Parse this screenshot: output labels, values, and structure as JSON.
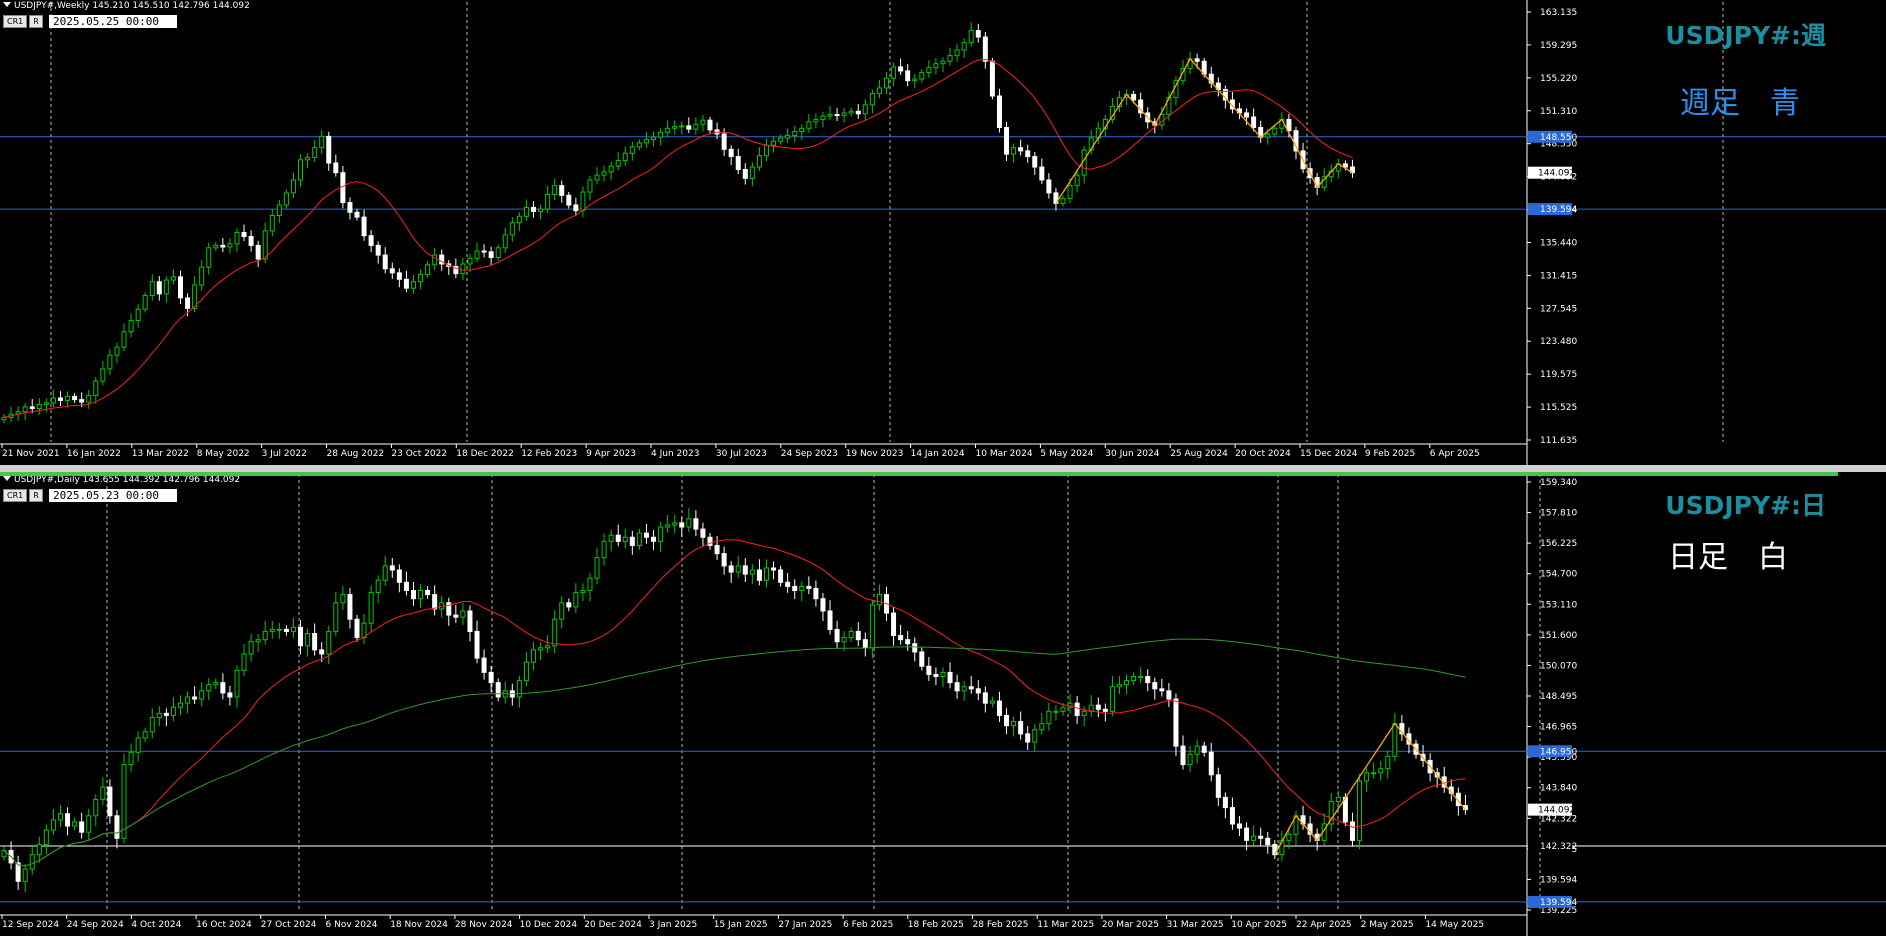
{
  "colors": {
    "background": "#000000",
    "up_candle": "#00c800",
    "down_candle": "#ffffff",
    "ma_red": "#ff2020",
    "ma_green": "#2e9a2e",
    "zigzag": "#ffa500",
    "hline_blue": "#2a6ad8",
    "hline_white": "#ffffff",
    "title_teal": "#1b8fa0",
    "weekly_note": "#2e8fe8"
  },
  "weekly": {
    "header": "USDJPY#,Weekly  145.210 145.510 142.796 144.092",
    "btn1": "CR1",
    "btn2": "R",
    "datetime": "2025.05.25 00:00",
    "title": "USDJPY#:週",
    "note": "週足　青",
    "price_labels": [
      "163.135",
      "159.295",
      "155.220",
      "151.310",
      "148.550",
      "144.092",
      "139.594",
      "135.440",
      "131.415",
      "127.545",
      "123.480",
      "119.575",
      "115.525",
      "111.635"
    ],
    "date_labels": [
      "21 Nov 2021",
      "16 Jan 2022",
      "13 Mar 2022",
      "8 May 2022",
      "3 Jul 2022",
      "28 Aug 2022",
      "23 Oct 2022",
      "18 Dec 2022",
      "12 Feb 2023",
      "9 Apr 2023",
      "4 Jun 2023",
      "30 Jul 2023",
      "24 Sep 2023",
      "19 Nov 2023",
      "14 Jan 2024",
      "10 Mar 2024",
      "5 May 2024",
      "30 Jun 2024",
      "25 Aug 2024",
      "20 Oct 2024",
      "15 Dec 2024",
      "9 Feb 2025",
      "6 Apr 2025"
    ],
    "hlines": [
      {
        "label": "148.550",
        "value": 148.55,
        "color": "#2a6ad8"
      },
      {
        "label": "139.594",
        "value": 139.594,
        "color": "#2a6ad8"
      }
    ],
    "current_label": "144.092"
  },
  "daily": {
    "header": "USDJPY#,Daily  143.655 144.392 142.796 144.092",
    "btn1": "CR1",
    "btn2": "R",
    "datetime": "2025.05.23 00:00",
    "title": "USDJPY#:日",
    "note": "日足　白",
    "price_labels": [
      "159.340",
      "157.810",
      "156.225",
      "154.700",
      "153.110",
      "151.600",
      "150.070",
      "148.495",
      "146.965",
      "145.390",
      "143.840",
      "142.322",
      "140.755",
      "139.594",
      "139.225"
    ],
    "date_labels": [
      "12 Sep 2024",
      "24 Sep 2024",
      "4 Oct 2024",
      "16 Oct 2024",
      "27 Oct 2024",
      "6 Nov 2024",
      "18 Nov 2024",
      "28 Nov 2024",
      "10 Dec 2024",
      "20 Dec 2024",
      "3 Jan 2025",
      "15 Jan 2025",
      "27 Jan 2025",
      "6 Feb 2025",
      "18 Feb 2025",
      "28 Feb 2025",
      "11 Mar 2025",
      "20 Mar 2025",
      "31 Mar 2025",
      "10 Apr 2025",
      "22 Apr 2025",
      "2 May 2025",
      "14 May 2025"
    ],
    "hlines": [
      {
        "label": "146.950",
        "value": 146.95,
        "color": "#2a6ad8"
      },
      {
        "label": "142.322",
        "value": 142.322,
        "color": "#ffffff"
      },
      {
        "label": "139.594",
        "value": 139.594,
        "color": "#2a6ad8"
      }
    ],
    "current_label": "144.092"
  },
  "chart_data": [
    {
      "type": "candlestick",
      "title": "USDJPY#:週",
      "timeframe": "Weekly",
      "ylim": [
        111.0,
        164.0
      ],
      "close_series": [
        113.8,
        114.2,
        114.5,
        115.1,
        114.9,
        115.4,
        115.6,
        116.2,
        115.9,
        116.4,
        116.0,
        115.7,
        116.5,
        118.3,
        119.8,
        121.5,
        122.5,
        124.4,
        125.8,
        127.2,
        128.9,
        130.6,
        129.1,
        130.8,
        131.2,
        128.6,
        127.3,
        130.2,
        132.4,
        134.8,
        135.1,
        134.9,
        135.3,
        136.7,
        136.2,
        135.1,
        133.4,
        136.9,
        138.8,
        140.1,
        141.6,
        143.2,
        145.7,
        146.0,
        147.2,
        148.6,
        145.3,
        144.1,
        140.4,
        139.2,
        138.6,
        136.3,
        135.1,
        133.9,
        132.2,
        131.7,
        130.9,
        129.8,
        130.6,
        131.5,
        132.7,
        133.9,
        132.8,
        132.5,
        131.6,
        132.8,
        133.5,
        134.4,
        134.3,
        133.6,
        134.8,
        136.4,
        137.9,
        138.7,
        139.8,
        139.3,
        139.6,
        141.4,
        142.5,
        141.3,
        140.1,
        139.4,
        141.7,
        143.2,
        143.8,
        144.2,
        144.9,
        145.6,
        146.5,
        147.3,
        147.8,
        148.2,
        148.5,
        149.1,
        149.6,
        149.8,
        149.9,
        149.5,
        150.1,
        150.6,
        149.4,
        148.9,
        147.0,
        146.1,
        144.5,
        143.4,
        144.8,
        146.2,
        147.5,
        148.0,
        148.4,
        148.7,
        149.2,
        149.6,
        150.4,
        150.7,
        151.1,
        151.3,
        151.2,
        151.5,
        151.7,
        151.4,
        152.5,
        153.9,
        154.6,
        155.8,
        157.2,
        156.7,
        155.5,
        155.7,
        156.5,
        157.1,
        157.6,
        157.9,
        158.6,
        159.3,
        160.2,
        161.7,
        160.9,
        157.9,
        153.6,
        149.7,
        146.4,
        147.2,
        146.8,
        146.1,
        144.8,
        143.2,
        141.6,
        140.3,
        140.9,
        142.5,
        143.8,
        146.9,
        148.4,
        149.6,
        150.7,
        152.3,
        153.4,
        153.8,
        153.1,
        151.5,
        150.4,
        150.0,
        151.3,
        153.4,
        155.5,
        157.0,
        158.2,
        157.9,
        156.3,
        155.2,
        154.4,
        153.1,
        152.0,
        151.5,
        151.0,
        149.7,
        148.5,
        148.9,
        149.6,
        150.7,
        149.3,
        146.8,
        144.6,
        143.5,
        142.3,
        143.6,
        144.3,
        145.2,
        144.8,
        144.1
      ]
    },
    {
      "type": "candlestick",
      "title": "USDJPY#:日",
      "timeframe": "Daily",
      "ylim": [
        139.2,
        160.0
      ],
      "close_series": [
        142.1,
        141.5,
        140.6,
        141.2,
        141.9,
        142.4,
        143.1,
        143.6,
        143.9,
        143.3,
        143.5,
        143.0,
        143.8,
        144.6,
        145.2,
        143.8,
        142.7,
        146.3,
        146.9,
        147.6,
        147.9,
        148.6,
        148.8,
        148.7,
        149.1,
        149.3,
        149.6,
        149.5,
        149.9,
        150.2,
        150.3,
        149.8,
        149.6,
        150.9,
        151.7,
        152.3,
        152.4,
        152.8,
        152.9,
        152.9,
        152.8,
        153.0,
        152.1,
        152.7,
        151.9,
        151.7,
        152.8,
        154.2,
        154.6,
        153.4,
        152.5,
        153.2,
        154.7,
        155.3,
        156.0,
        155.8,
        155.2,
        154.8,
        154.4,
        154.8,
        154.6,
        153.9,
        154.2,
        153.6,
        153.5,
        153.8,
        152.8,
        151.5,
        150.8,
        150.3,
        149.6,
        149.9,
        149.6,
        150.4,
        151.3,
        151.9,
        152.0,
        152.1,
        153.4,
        154.2,
        154.0,
        154.7,
        154.8,
        155.4,
        156.4,
        157.2,
        157.5,
        157.2,
        157.4,
        157.0,
        157.6,
        157.4,
        157.2,
        157.9,
        158.0,
        158.1,
        157.9,
        158.3,
        157.8,
        157.4,
        157.0,
        156.6,
        156.0,
        155.7,
        156.0,
        155.6,
        155.8,
        155.3,
        155.9,
        155.8,
        155.2,
        155.0,
        154.8,
        155.0,
        154.9,
        154.4,
        153.8,
        152.9,
        152.3,
        152.5,
        152.8,
        152.4,
        152.0,
        154.1,
        154.6,
        153.7,
        152.6,
        152.4,
        152.2,
        151.8,
        151.1,
        150.7,
        150.6,
        150.8,
        150.3,
        149.9,
        150.1,
        150.0,
        149.8,
        149.3,
        149.4,
        148.7,
        148.2,
        148.4,
        147.8,
        147.4,
        148.0,
        148.3,
        148.9,
        148.9,
        149.1,
        149.3,
        148.7,
        148.9,
        149.2,
        149.0,
        148.9,
        150.1,
        150.2,
        150.4,
        150.6,
        150.6,
        150.3,
        150.0,
        149.9,
        149.5,
        147.2,
        146.3,
        146.8,
        147.2,
        146.9,
        145.8,
        144.7,
        144.2,
        143.4,
        143.2,
        142.6,
        142.8,
        142.7,
        142.4,
        141.9,
        142.6,
        142.9,
        143.8,
        143.4,
        142.9,
        142.6,
        143.4,
        144.5,
        144.7,
        143.5,
        142.6,
        145.5,
        145.9,
        145.9,
        146.1,
        146.7,
        148.3,
        147.8,
        147.3,
        146.8,
        146.5,
        145.9,
        145.7,
        145.2,
        144.9,
        144.3,
        144.1
      ]
    }
  ]
}
